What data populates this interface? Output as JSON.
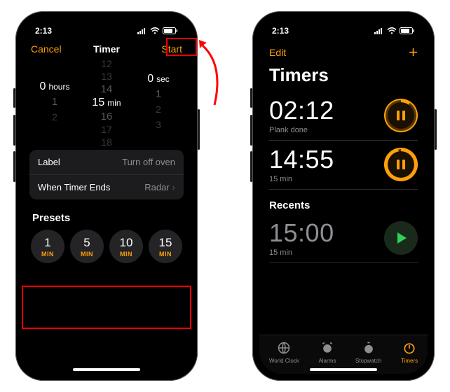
{
  "status": {
    "time": "2:13"
  },
  "left": {
    "nav": {
      "cancel": "Cancel",
      "title": "Timer",
      "start": "Start"
    },
    "picker": {
      "hours": {
        "value": "0",
        "unit": "hours",
        "above": [],
        "below": [
          "1",
          "2"
        ]
      },
      "minutes": {
        "value": "15",
        "unit": "min",
        "above": [
          "12",
          "13",
          "14"
        ],
        "below": [
          "16",
          "17",
          "18"
        ]
      },
      "seconds": {
        "value": "0",
        "unit": "sec",
        "above": [],
        "below": [
          "1",
          "2",
          "3"
        ]
      }
    },
    "settings": {
      "label_key": "Label",
      "label_val": "Turn off oven",
      "ends_key": "When Timer Ends",
      "ends_val": "Radar"
    },
    "presets_title": "Presets",
    "presets": [
      {
        "n": "1",
        "u": "MIN"
      },
      {
        "n": "5",
        "u": "MIN"
      },
      {
        "n": "10",
        "u": "MIN"
      },
      {
        "n": "15",
        "u": "MIN"
      }
    ]
  },
  "right": {
    "nav": {
      "edit": "Edit",
      "add": "+"
    },
    "title": "Timers",
    "timers": [
      {
        "time": "02:12",
        "sub": "Plank done"
      },
      {
        "time": "14:55",
        "sub": "15 min"
      }
    ],
    "recents_title": "Recents",
    "recents": [
      {
        "time": "15:00",
        "sub": "15 min"
      }
    ],
    "tabs": [
      {
        "label": "World Clock"
      },
      {
        "label": "Alarms"
      },
      {
        "label": "Stopwatch"
      },
      {
        "label": "Timers"
      }
    ]
  }
}
